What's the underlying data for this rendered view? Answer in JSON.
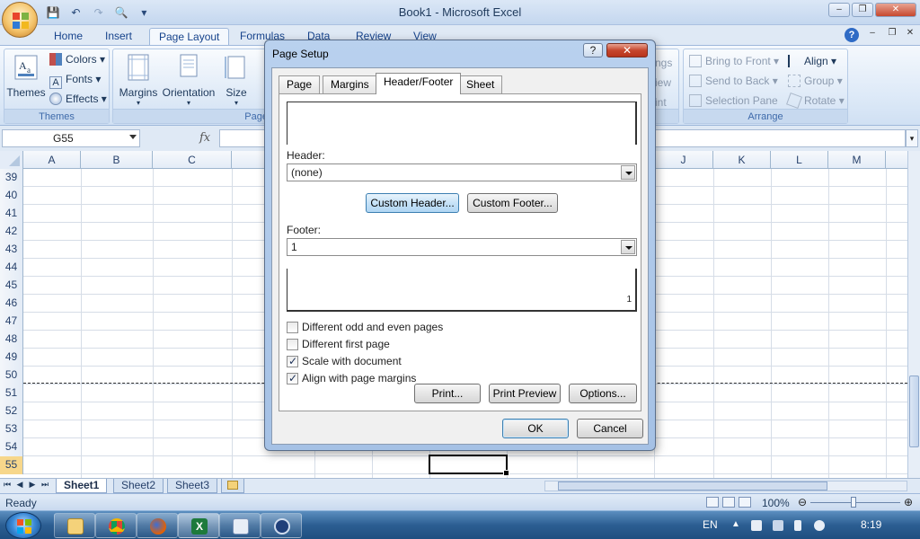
{
  "window": {
    "title": "Book1 - Microsoft Excel",
    "minimize": "–",
    "maximize": "❐",
    "close": "✕"
  },
  "quick_access": {
    "save": "💾",
    "undo": "↶",
    "redo": "↷",
    "preview": "🔍",
    "customize": "▾"
  },
  "ribbon": {
    "tabs": [
      "Home",
      "Insert",
      "Page Layout",
      "Formulas",
      "Data",
      "Review",
      "View"
    ],
    "active_tab": "Page Layout",
    "themes_group": {
      "label": "Themes",
      "themes_button": "Themes",
      "colors": "Colors",
      "fonts": "Fonts",
      "effects": "Effects"
    },
    "page_setup_group": {
      "label": "Page",
      "margins": "Margins",
      "orientation": "Orientation",
      "size": "Size"
    },
    "partial_right": {
      "line1": "ngs",
      "line2": "iew",
      "line3": "int"
    },
    "arrange_group": {
      "label": "Arrange",
      "bring_to_front": "Bring to Front",
      "send_to_back": "Send to Back",
      "selection_pane": "Selection Pane",
      "align": "Align",
      "group": "Group",
      "rotate": "Rotate"
    },
    "help": "?"
  },
  "formula_bar": {
    "name_box": "G55",
    "fx": "fx",
    "value": ""
  },
  "grid": {
    "columns": [
      "A",
      "B",
      "C",
      "",
      "",
      "",
      "",
      "",
      "J",
      "K",
      "L",
      "M"
    ],
    "rows": [
      "39",
      "40",
      "41",
      "42",
      "43",
      "44",
      "45",
      "46",
      "47",
      "48",
      "49",
      "50",
      "51",
      "52",
      "53",
      "54",
      "55"
    ]
  },
  "sheets": {
    "tabs": [
      "Sheet1",
      "Sheet2",
      "Sheet3"
    ],
    "active": "Sheet1",
    "nav_first": "⏮",
    "nav_prev": "◀",
    "nav_next": "▶",
    "nav_last": "⏭"
  },
  "status": {
    "text": "Ready",
    "zoom": "100%"
  },
  "taskbar": {
    "lang": "EN",
    "time": "8:19"
  },
  "dialog": {
    "title": "Page Setup",
    "help": "?",
    "close": "✕",
    "tabs": [
      "Page",
      "Margins",
      "Header/Footer",
      "Sheet"
    ],
    "active_tab": "Header/Footer",
    "header_label": "Header:",
    "header_value": "(none)",
    "custom_header": "Custom Header...",
    "custom_footer": "Custom Footer...",
    "footer_label": "Footer:",
    "footer_value": "1",
    "footer_preview_text": "1",
    "checkboxes": [
      {
        "label": "Different odd and even pages",
        "checked": false
      },
      {
        "label": "Different first page",
        "checked": false
      },
      {
        "label": "Scale with document",
        "checked": true
      },
      {
        "label": "Align with page margins",
        "checked": true
      }
    ],
    "print": "Print...",
    "print_preview": "Print Preview",
    "options": "Options...",
    "ok": "OK",
    "cancel": "Cancel"
  },
  "colors": {
    "accent": "#15428b",
    "ribbon": "#dbe8f7",
    "dialog_frame": "#b9d1ee",
    "taskbar": "#2c5e92"
  }
}
